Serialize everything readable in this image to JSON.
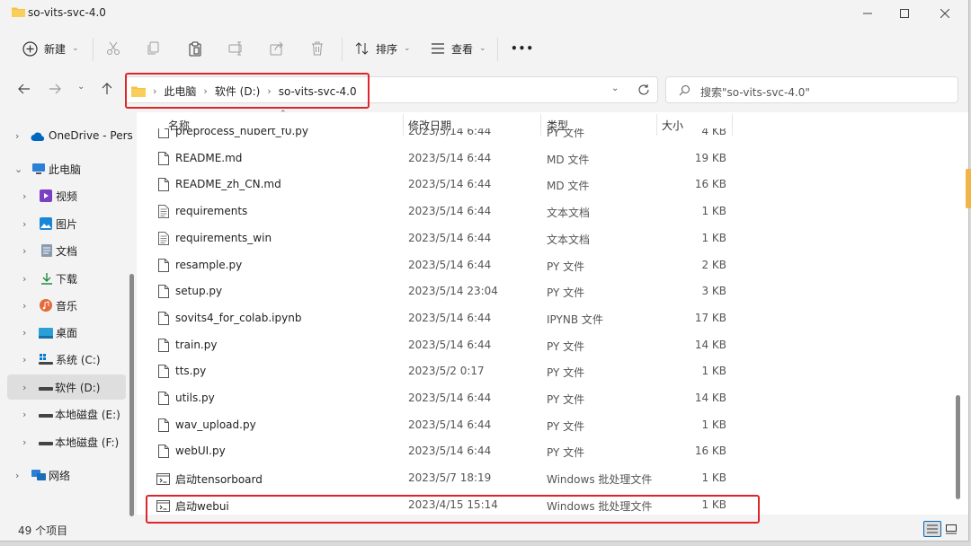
{
  "window": {
    "title": "so-vits-svc-4.0"
  },
  "toolbar": {
    "new_label": "新建",
    "sort_label": "排序",
    "view_label": "查看",
    "more_label": "•••"
  },
  "address": {
    "crumbs": [
      "此电脑",
      "软件 (D:)",
      "so-vits-svc-4.0"
    ]
  },
  "search": {
    "placeholder": "搜索\"so-vits-svc-4.0\""
  },
  "sidebar": {
    "items": [
      {
        "label": "OneDrive - Pers",
        "icon": "cloud-icon"
      },
      {
        "label": "此电脑",
        "icon": "computer-icon"
      },
      {
        "label": "视频",
        "icon": "video-icon"
      },
      {
        "label": "图片",
        "icon": "pictures-icon"
      },
      {
        "label": "文档",
        "icon": "documents-icon"
      },
      {
        "label": "下载",
        "icon": "download-icon"
      },
      {
        "label": "音乐",
        "icon": "music-icon"
      },
      {
        "label": "桌面",
        "icon": "desktop-icon"
      },
      {
        "label": "系统 (C:)",
        "icon": "windows-drive-icon"
      },
      {
        "label": "软件 (D:)",
        "icon": "drive-icon"
      },
      {
        "label": "本地磁盘 (E:)",
        "icon": "drive-icon"
      },
      {
        "label": "本地磁盘 (F:)",
        "icon": "drive-icon"
      },
      {
        "label": "网络",
        "icon": "network-icon"
      }
    ]
  },
  "columns": {
    "name": "名称",
    "date": "修改日期",
    "type": "类型",
    "size": "大小"
  },
  "files": [
    {
      "name": "preprocess_hubert_f0.py",
      "date": "2023/5/14 6:44",
      "type": "PY 文件",
      "size": "4 KB",
      "icon": "file-icon"
    },
    {
      "name": "README.md",
      "date": "2023/5/14 6:44",
      "type": "MD 文件",
      "size": "19 KB",
      "icon": "file-icon"
    },
    {
      "name": "README_zh_CN.md",
      "date": "2023/5/14 6:44",
      "type": "MD 文件",
      "size": "16 KB",
      "icon": "file-icon"
    },
    {
      "name": "requirements",
      "date": "2023/5/14 6:44",
      "type": "文本文档",
      "size": "1 KB",
      "icon": "text-file-icon"
    },
    {
      "name": "requirements_win",
      "date": "2023/5/14 6:44",
      "type": "文本文档",
      "size": "1 KB",
      "icon": "text-file-icon"
    },
    {
      "name": "resample.py",
      "date": "2023/5/14 6:44",
      "type": "PY 文件",
      "size": "2 KB",
      "icon": "file-icon"
    },
    {
      "name": "setup.py",
      "date": "2023/5/14 23:04",
      "type": "PY 文件",
      "size": "3 KB",
      "icon": "file-icon"
    },
    {
      "name": "sovits4_for_colab.ipynb",
      "date": "2023/5/14 6:44",
      "type": "IPYNB 文件",
      "size": "17 KB",
      "icon": "file-icon"
    },
    {
      "name": "train.py",
      "date": "2023/5/14 6:44",
      "type": "PY 文件",
      "size": "14 KB",
      "icon": "file-icon"
    },
    {
      "name": "tts.py",
      "date": "2023/5/2 0:17",
      "type": "PY 文件",
      "size": "1 KB",
      "icon": "file-icon"
    },
    {
      "name": "utils.py",
      "date": "2023/5/14 6:44",
      "type": "PY 文件",
      "size": "14 KB",
      "icon": "file-icon"
    },
    {
      "name": "wav_upload.py",
      "date": "2023/5/14 6:44",
      "type": "PY 文件",
      "size": "1 KB",
      "icon": "file-icon"
    },
    {
      "name": "webUI.py",
      "date": "2023/5/14 6:44",
      "type": "PY 文件",
      "size": "16 KB",
      "icon": "file-icon"
    },
    {
      "name": "启动tensorboard",
      "date": "2023/5/7 18:19",
      "type": "Windows 批处理文件",
      "size": "1 KB",
      "icon": "batch-file-icon"
    },
    {
      "name": "启动webui",
      "date": "2023/4/15 15:14",
      "type": "Windows 批处理文件",
      "size": "1 KB",
      "icon": "batch-file-icon"
    }
  ],
  "status": {
    "item_count": "49 个项目"
  },
  "colors": {
    "highlight": "#e0252a",
    "accent": "#0067c0",
    "folder": "#f5c342"
  }
}
